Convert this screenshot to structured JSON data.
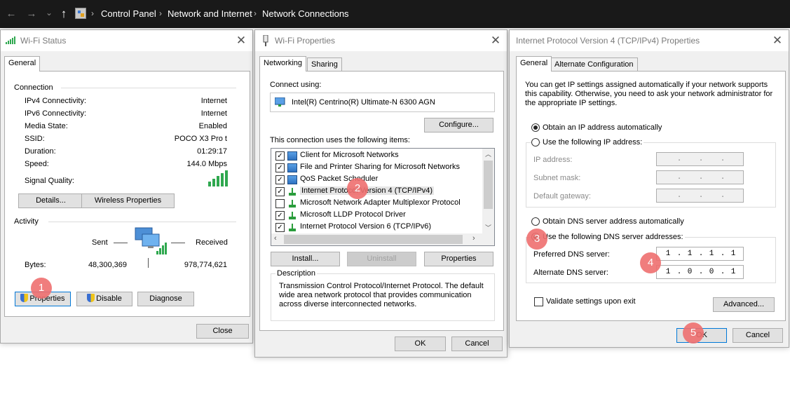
{
  "explorer": {
    "back_icon": "←",
    "forward_icon": "→",
    "dropdown_icon": "⌄",
    "up_icon": "↑",
    "breadcrumb": [
      "Control Panel",
      "Network and Internet",
      "Network Connections"
    ],
    "sep": "›"
  },
  "wifi_status": {
    "title": "Wi-Fi Status",
    "tab_general": "General",
    "connection_heading": "Connection",
    "rows": [
      {
        "label": "IPv4 Connectivity:",
        "value": "Internet"
      },
      {
        "label": "IPv6 Connectivity:",
        "value": "Internet"
      },
      {
        "label": "Media State:",
        "value": "Enabled"
      },
      {
        "label": "SSID:",
        "value": "POCO X3 Pro t"
      },
      {
        "label": "Duration:",
        "value": "01:29:17"
      },
      {
        "label": "Speed:",
        "value": "144.0 Mbps"
      }
    ],
    "signal_label": "Signal Quality:",
    "details_button": "Details...",
    "wireless_properties_button": "Wireless Properties",
    "activity_heading": "Activity",
    "sent_label": "Sent",
    "received_label": "Received",
    "bytes_label": "Bytes:",
    "bytes_sent": "48,300,369",
    "bytes_received": "978,774,621",
    "properties_button": "Properties",
    "disable_button": "Disable",
    "diagnose_button": "Diagnose",
    "close_button": "Close"
  },
  "wifi_properties": {
    "title": "Wi-Fi Properties",
    "tab_networking": "Networking",
    "tab_sharing": "Sharing",
    "connect_using_label": "Connect using:",
    "adapter_name": "Intel(R) Centrino(R) Ultimate-N 6300 AGN",
    "configure_button": "Configure...",
    "items_label": "This connection uses the following items:",
    "items": [
      {
        "checked": true,
        "label": "Client for Microsoft Networks",
        "icon": "network-client-icon"
      },
      {
        "checked": true,
        "label": "File and Printer Sharing for Microsoft Networks",
        "icon": "network-service-icon"
      },
      {
        "checked": true,
        "label": "QoS Packet Scheduler",
        "icon": "network-service-icon"
      },
      {
        "checked": true,
        "label": "Internet Protocol Version 4 (TCP/IPv4)",
        "icon": "protocol-icon"
      },
      {
        "checked": false,
        "label": "Microsoft Network Adapter Multiplexor Protocol",
        "icon": "protocol-icon"
      },
      {
        "checked": true,
        "label": "Microsoft LLDP Protocol Driver",
        "icon": "protocol-icon"
      },
      {
        "checked": true,
        "label": "Internet Protocol Version 6 (TCP/IPv6)",
        "icon": "protocol-icon"
      }
    ],
    "install_button": "Install...",
    "uninstall_button": "Uninstall",
    "properties_button": "Properties",
    "description_heading": "Description",
    "description_text": "Transmission Control Protocol/Internet Protocol. The default wide area network protocol that provides communication across diverse interconnected networks.",
    "ok_button": "OK",
    "cancel_button": "Cancel"
  },
  "ipv4_properties": {
    "title": "Internet Protocol Version 4 (TCP/IPv4) Properties",
    "tab_general": "General",
    "tab_alternate": "Alternate Configuration",
    "intro_text": "You can get IP settings assigned automatically if your network supports this capability. Otherwise, you need to ask your network administrator for the appropriate IP settings.",
    "radio_obtain_ip": "Obtain an IP address automatically",
    "radio_use_ip": "Use the following IP address:",
    "ip_address_label": "IP address:",
    "subnet_mask_label": "Subnet mask:",
    "default_gateway_label": "Default gateway:",
    "radio_obtain_dns": "Obtain DNS server address automatically",
    "radio_use_dns": "Use the following DNS server addresses:",
    "preferred_dns_label": "Preferred DNS server:",
    "preferred_dns_octets": [
      "1",
      "1",
      "1",
      "1"
    ],
    "alternate_dns_label": "Alternate DNS server:",
    "alternate_dns_octets": [
      "1",
      "0",
      "0",
      "1"
    ],
    "validate_label": "Validate settings upon exit",
    "advanced_button": "Advanced...",
    "ok_button": "OK",
    "cancel_button": "Cancel"
  },
  "step_badges": [
    "1",
    "2",
    "3",
    "4",
    "5"
  ],
  "colors": {
    "explorer_bg": "#191919",
    "dialog_bg": "#f0f0f0",
    "badge": "#ef6f6f",
    "signal_green": "#2fa84f",
    "focus_blue": "#0078d7"
  }
}
